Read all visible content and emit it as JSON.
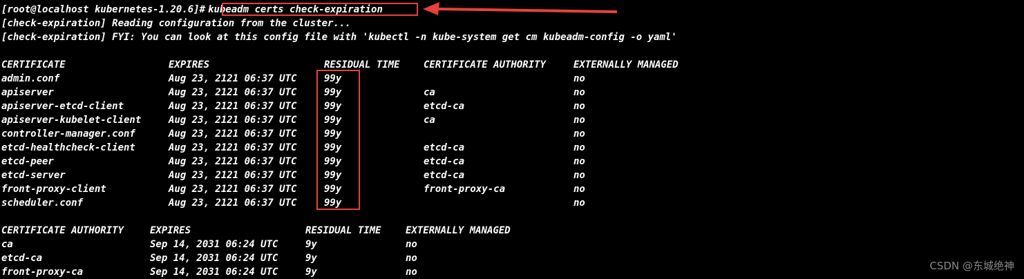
{
  "terminal": {
    "prompt": "[root@localhost kubernetes-1.20.6]#",
    "command": "kubeadm certs check-expiration",
    "output_lines": [
      "[check-expiration] Reading configuration from the cluster...",
      "[check-expiration] FYI: You can look at this config file with 'kubectl -n kube-system get cm kubeadm-config -o yaml'"
    ]
  },
  "certificates_table": {
    "headers": [
      "CERTIFICATE",
      "EXPIRES",
      "RESIDUAL TIME",
      "CERTIFICATE AUTHORITY",
      "EXTERNALLY MANAGED"
    ],
    "rows": [
      [
        "admin.conf",
        "Aug 23, 2121 06:37 UTC",
        "99y",
        "",
        "no"
      ],
      [
        "apiserver",
        "Aug 23, 2121 06:37 UTC",
        "99y",
        "ca",
        "no"
      ],
      [
        "apiserver-etcd-client",
        "Aug 23, 2121 06:37 UTC",
        "99y",
        "etcd-ca",
        "no"
      ],
      [
        "apiserver-kubelet-client",
        "Aug 23, 2121 06:37 UTC",
        "99y",
        "ca",
        "no"
      ],
      [
        "controller-manager.conf",
        "Aug 23, 2121 06:37 UTC",
        "99y",
        "",
        "no"
      ],
      [
        "etcd-healthcheck-client",
        "Aug 23, 2121 06:37 UTC",
        "99y",
        "etcd-ca",
        "no"
      ],
      [
        "etcd-peer",
        "Aug 23, 2121 06:37 UTC",
        "99y",
        "etcd-ca",
        "no"
      ],
      [
        "etcd-server",
        "Aug 23, 2121 06:37 UTC",
        "99y",
        "etcd-ca",
        "no"
      ],
      [
        "front-proxy-client",
        "Aug 23, 2121 06:37 UTC",
        "99y",
        "front-proxy-ca",
        "no"
      ],
      [
        "scheduler.conf",
        "Aug 23, 2121 06:37 UTC",
        "99y",
        "",
        "no"
      ]
    ]
  },
  "ca_table": {
    "headers": [
      "CERTIFICATE AUTHORITY",
      "EXPIRES",
      "RESIDUAL TIME",
      "EXTERNALLY MANAGED"
    ],
    "rows": [
      [
        "ca",
        "Sep 14, 2031 06:24 UTC",
        "9y",
        "no"
      ],
      [
        "etcd-ca",
        "Sep 14, 2031 06:24 UTC",
        "9y",
        "no"
      ],
      [
        "front-proxy-ca",
        "Sep 14, 2031 06:24 UTC",
        "9y",
        "no"
      ]
    ]
  },
  "watermark": "CSDN @东城绝神",
  "colors": {
    "background": "#000000",
    "text": "#ffffff",
    "annotation": "#e8413d",
    "watermark": "#8a8a8a"
  }
}
